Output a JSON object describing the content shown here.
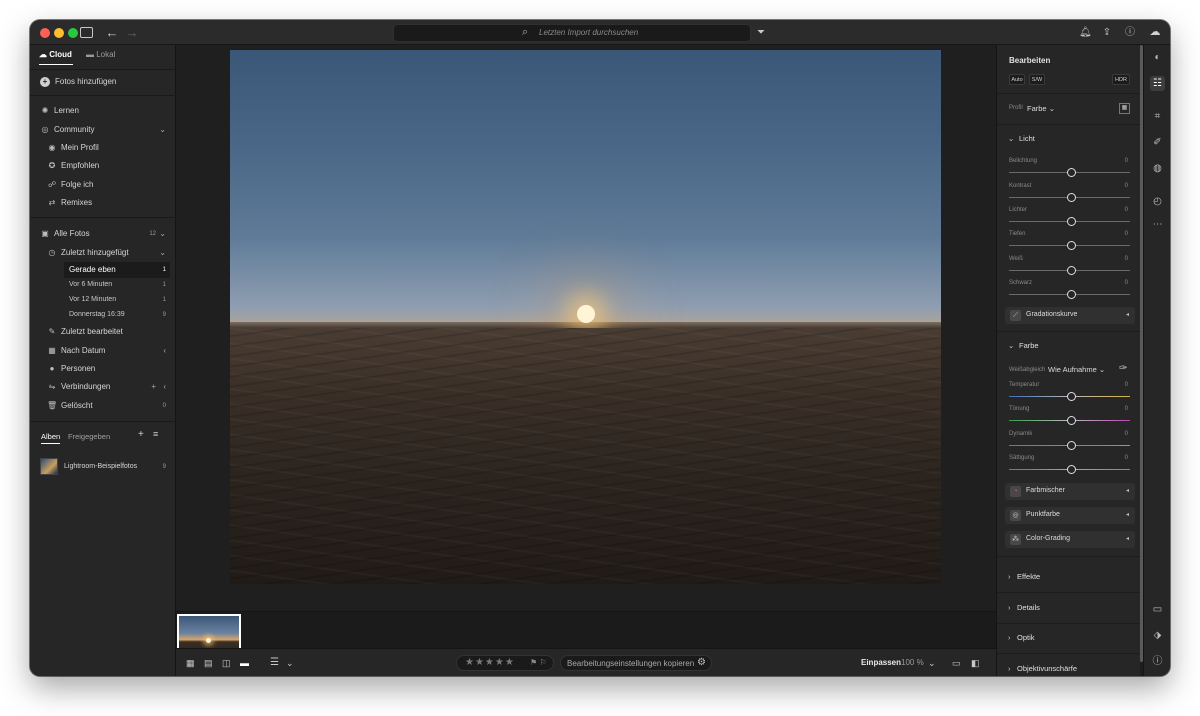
{
  "titlebar": {
    "search_placeholder": "Letzten Import durchsuchen",
    "icons": [
      "sidebar-toggle-icon",
      "back-arrow-icon",
      "forward-arrow-icon",
      "filter-icon",
      "bell-icon",
      "share-icon",
      "help-icon",
      "cloud-sync-icon"
    ]
  },
  "left": {
    "tabs": {
      "cloud": "Cloud",
      "local": "Lokal"
    },
    "add_photos": "Fotos hinzufügen",
    "learn": "Lernen",
    "community": "Community",
    "community_items": [
      "Mein Profil",
      "Empfohlen",
      "Folge ich",
      "Remixes"
    ],
    "all_photos": {
      "label": "Alle Fotos",
      "count": "12"
    },
    "recently_added": "Zuletzt hinzugefügt",
    "recent_items": [
      {
        "label": "Gerade eben",
        "count": "1"
      },
      {
        "label": "Vor 6 Minuten",
        "count": "1"
      },
      {
        "label": "Vor 12 Minuten",
        "count": "1"
      },
      {
        "label": "Donnerstag 16:39",
        "count": "9"
      }
    ],
    "recently_edited": "Zuletzt bearbeitet",
    "by_date": "Nach Datum",
    "people": "Personen",
    "connections": "Verbindungen",
    "deleted": {
      "label": "Gelöscht",
      "count": "0"
    },
    "album_tabs": {
      "albums": "Alben",
      "shared": "Freigegeben"
    },
    "albums": [
      {
        "label": "Lightroom-Beispielfotos",
        "count": "9"
      }
    ]
  },
  "bottombar": {
    "copy_settings": "Bearbeitungseinstellungen kopieren",
    "fit": "Einpassen",
    "zoom": "100 %"
  },
  "edit": {
    "title": "Bearbeiten",
    "auto": "Auto",
    "bw": "S/W",
    "hdr": "HDR",
    "profile_label": "Profil",
    "profile_value": "Farbe",
    "light_header": "Licht",
    "light_sliders": [
      {
        "label": "Belichtung",
        "value": "0"
      },
      {
        "label": "Kontrast",
        "value": "0"
      },
      {
        "label": "Lichter",
        "value": "0"
      },
      {
        "label": "Tiefen",
        "value": "0"
      },
      {
        "label": "Weiß",
        "value": "0"
      },
      {
        "label": "Schwarz",
        "value": "0"
      }
    ],
    "tone_curve": "Gradationskurve",
    "color_header": "Farbe",
    "wb_label": "Weißabgleich",
    "wb_value": "Wie Aufnahme",
    "color_sliders": [
      {
        "label": "Temperatur",
        "value": "0"
      },
      {
        "label": "Tönung",
        "value": "0"
      },
      {
        "label": "Dynamik",
        "value": "0"
      },
      {
        "label": "Sättigung",
        "value": "0"
      }
    ],
    "color_mixer": "Farbmischer",
    "point_color": "Punktfarbe",
    "color_grading": "Color-Grading",
    "effects": "Effekte",
    "details": "Details",
    "optics": "Optik",
    "lens_blur": "Objektivunschärfe"
  }
}
